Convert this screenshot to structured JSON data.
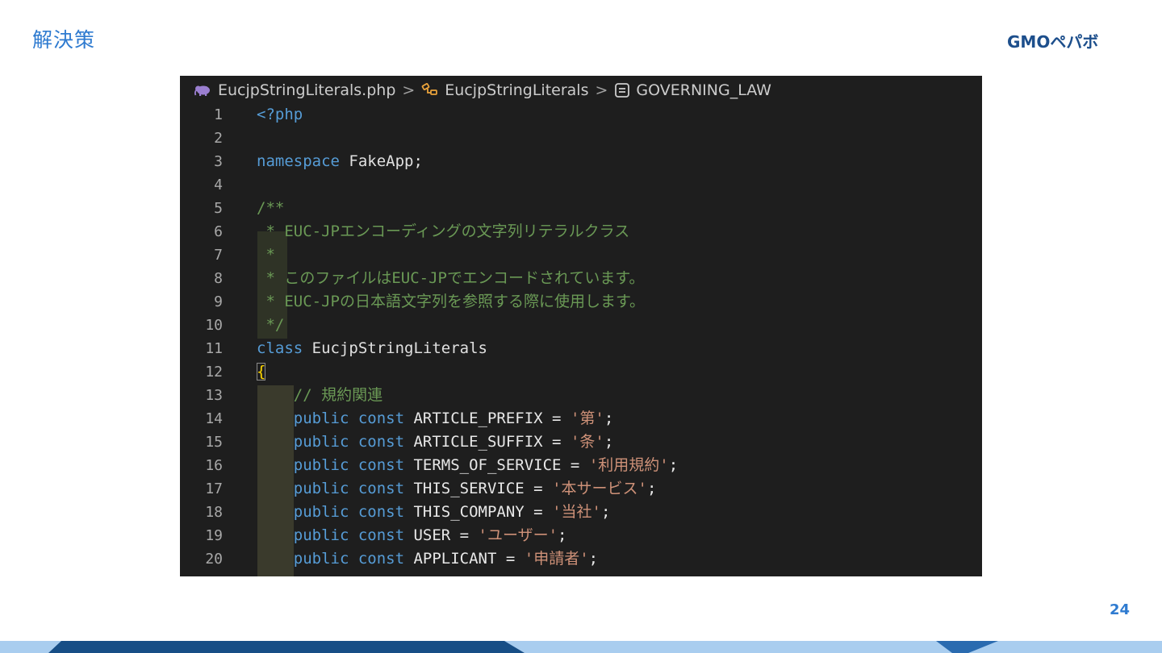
{
  "slide": {
    "title": "解決策",
    "logo_text": "GMOペパボ",
    "page_number": "24"
  },
  "editor": {
    "breadcrumb": {
      "file": "EucjpStringLiterals.php",
      "class": "EucjpStringLiterals",
      "constant": "GOVERNING_LAW",
      "separator": ">"
    },
    "lines": [
      {
        "n": "1",
        "tokens": [
          {
            "t": "<?php",
            "c": "tag"
          }
        ]
      },
      {
        "n": "2",
        "tokens": []
      },
      {
        "n": "3",
        "tokens": [
          {
            "t": "namespace",
            "c": "kw"
          },
          {
            "t": " FakeApp;",
            "c": "cls"
          }
        ]
      },
      {
        "n": "4",
        "tokens": []
      },
      {
        "n": "5",
        "tokens": [
          {
            "t": "/**",
            "c": "cm"
          }
        ]
      },
      {
        "n": "6",
        "tokens": [
          {
            "t": " * EUC-JPエンコーディングの文字列リテラルクラス",
            "c": "cm"
          }
        ]
      },
      {
        "n": "7",
        "tokens": [
          {
            "t": " *",
            "c": "cm"
          }
        ]
      },
      {
        "n": "8",
        "tokens": [
          {
            "t": " * このファイルはEUC-JPでエンコードされています。",
            "c": "cm"
          }
        ]
      },
      {
        "n": "9",
        "tokens": [
          {
            "t": " * EUC-JPの日本語文字列を参照する際に使用します。",
            "c": "cm"
          }
        ]
      },
      {
        "n": "10",
        "tokens": [
          {
            "t": " */",
            "c": "cm"
          }
        ]
      },
      {
        "n": "11",
        "tokens": [
          {
            "t": "class",
            "c": "kw"
          },
          {
            "t": " EucjpStringLiterals",
            "c": "cls"
          }
        ]
      },
      {
        "n": "12",
        "tokens": [
          {
            "t": "{",
            "c": "brace"
          }
        ]
      },
      {
        "n": "13",
        "tokens": [
          {
            "t": "    // 規約関連",
            "c": "cm"
          }
        ]
      },
      {
        "n": "14",
        "tokens": [
          {
            "t": "    public const",
            "c": "kw"
          },
          {
            "t": " ARTICLE_PREFIX = ",
            "c": "const-name"
          },
          {
            "t": "'第'",
            "c": "str"
          },
          {
            "t": ";",
            "c": "const-name"
          }
        ]
      },
      {
        "n": "15",
        "tokens": [
          {
            "t": "    public const",
            "c": "kw"
          },
          {
            "t": " ARTICLE_SUFFIX = ",
            "c": "const-name"
          },
          {
            "t": "'条'",
            "c": "str"
          },
          {
            "t": ";",
            "c": "const-name"
          }
        ]
      },
      {
        "n": "16",
        "tokens": [
          {
            "t": "    public const",
            "c": "kw"
          },
          {
            "t": " TERMS_OF_SERVICE = ",
            "c": "const-name"
          },
          {
            "t": "'利用規約'",
            "c": "str"
          },
          {
            "t": ";",
            "c": "const-name"
          }
        ]
      },
      {
        "n": "17",
        "tokens": [
          {
            "t": "    public const",
            "c": "kw"
          },
          {
            "t": " THIS_SERVICE = ",
            "c": "const-name"
          },
          {
            "t": "'本サービス'",
            "c": "str"
          },
          {
            "t": ";",
            "c": "const-name"
          }
        ]
      },
      {
        "n": "18",
        "tokens": [
          {
            "t": "    public const",
            "c": "kw"
          },
          {
            "t": " THIS_COMPANY = ",
            "c": "const-name"
          },
          {
            "t": "'当社'",
            "c": "str"
          },
          {
            "t": ";",
            "c": "const-name"
          }
        ]
      },
      {
        "n": "19",
        "tokens": [
          {
            "t": "    public const",
            "c": "kw"
          },
          {
            "t": " USER = ",
            "c": "const-name"
          },
          {
            "t": "'ユーザー'",
            "c": "str"
          },
          {
            "t": ";",
            "c": "const-name"
          }
        ]
      },
      {
        "n": "20",
        "tokens": [
          {
            "t": "    public const",
            "c": "kw"
          },
          {
            "t": " APPLICANT = ",
            "c": "const-name"
          },
          {
            "t": "'申請者'",
            "c": "str"
          },
          {
            "t": ";",
            "c": "const-name"
          }
        ]
      }
    ]
  },
  "colors": {
    "accent": "#2f7bd0",
    "brand_dark": "#1d4f8c",
    "band_light": "#a9cdef",
    "band_dark": "#174e86",
    "editor_bg": "#1e1e1e"
  },
  "icons": {
    "file": "php-elephant-icon",
    "class": "class-symbol-icon",
    "constant": "constant-symbol-icon"
  }
}
